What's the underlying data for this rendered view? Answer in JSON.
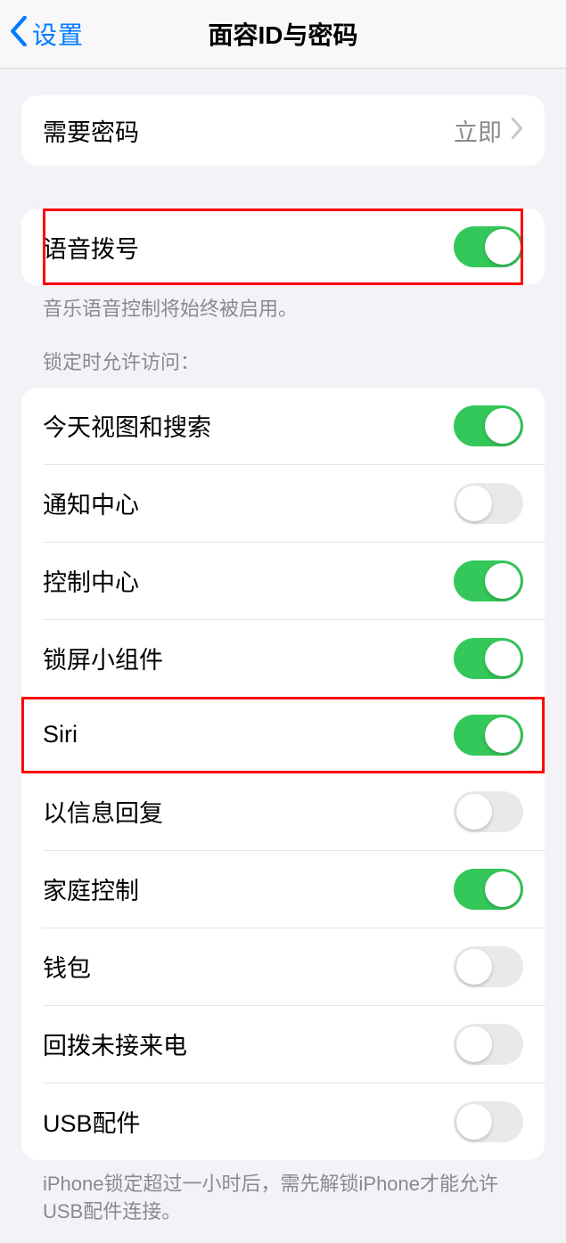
{
  "nav": {
    "back_label": "设置",
    "title": "面容ID与密码"
  },
  "group1": {
    "require_passcode": {
      "label": "需要密码",
      "value": "立即"
    }
  },
  "group2": {
    "voice_dial": {
      "label": "语音拨号",
      "on": true
    },
    "footer": "音乐语音控制将始终被启用。"
  },
  "group3": {
    "header": "锁定时允许访问：",
    "items": [
      {
        "label": "今天视图和搜索",
        "on": true
      },
      {
        "label": "通知中心",
        "on": false
      },
      {
        "label": "控制中心",
        "on": true
      },
      {
        "label": "锁屏小组件",
        "on": true
      },
      {
        "label": "Siri",
        "on": true
      },
      {
        "label": "以信息回复",
        "on": false
      },
      {
        "label": "家庭控制",
        "on": true
      },
      {
        "label": "钱包",
        "on": false
      },
      {
        "label": "回拨未接来电",
        "on": false
      },
      {
        "label": "USB配件",
        "on": false
      }
    ],
    "footer": "iPhone锁定超过一小时后，需先解锁iPhone才能允许USB配件连接。"
  },
  "highlights": {
    "voice_dial": true,
    "siri_index": 4
  }
}
